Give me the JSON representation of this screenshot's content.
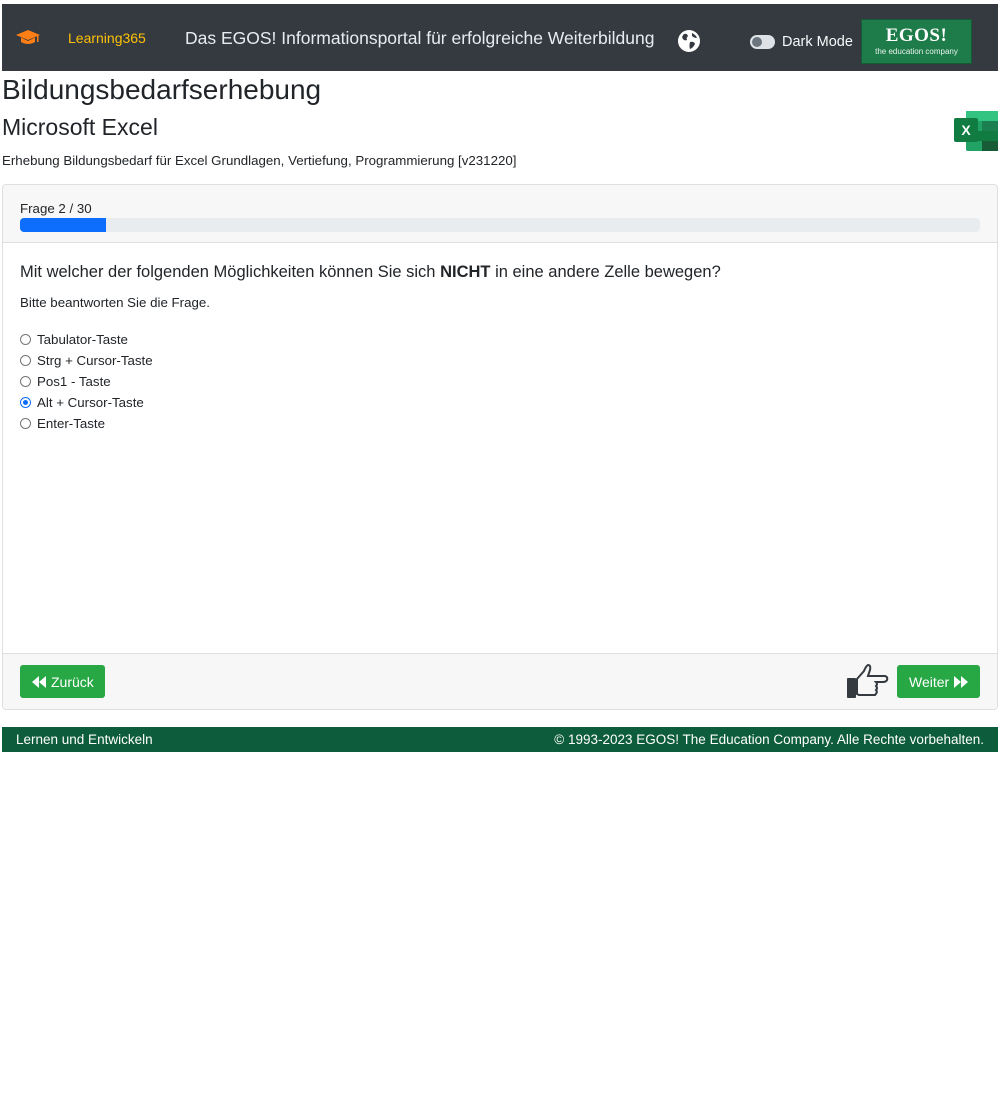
{
  "navbar": {
    "brand_icon": "graduation-cap-icon",
    "brand": "Learning365",
    "portal_title": "Das EGOS! Informationsportal für erfolgreiche Weiterbildung",
    "globe_icon": "globe-icon",
    "dark_mode_label": "Dark Mode",
    "dark_mode_on": false,
    "logo": {
      "main": "EGOS!",
      "tagline": "the education company"
    }
  },
  "header": {
    "title": "Bildungsbedarfserhebung",
    "subject": "Microsoft Excel",
    "subject_icon": "excel-icon",
    "description": "Erhebung Bildungsbedarf für Excel Grundlagen, Vertiefung, Programmierung [v231220]"
  },
  "quiz": {
    "counter": "Frage 2 / 30",
    "progress": 0.09,
    "question_before": "Mit welcher der folgenden Möglichkeiten können Sie sich ",
    "question_emphasis": "NICHT",
    "question_after": " in eine andere Zelle bewegen?",
    "hint": "Bitte beantworten Sie die Frage.",
    "options": [
      {
        "label": "Tabulator-Taste",
        "checked": false
      },
      {
        "label": "Strg + Cursor-Taste",
        "checked": false
      },
      {
        "label": "Pos1 - Taste",
        "checked": false
      },
      {
        "label": "Alt + Cursor-Taste",
        "checked": true
      },
      {
        "label": "Enter-Taste",
        "checked": false
      }
    ],
    "back_label": "Zurück",
    "next_label": "Weiter",
    "thumb_icon": "thumbs-up-pointing-icon"
  },
  "footer": {
    "left": "Lernen und Entwickeln",
    "right": "© 1993-2023 EGOS! The Education Company. Alle Rechte vorbehalten."
  },
  "colors": {
    "navbar_bg": "#343a40",
    "brand": "#ffc107",
    "accent_green": "#28a745",
    "footer_bg": "#0d5c3b",
    "progress_blue": "#0d6efd"
  }
}
